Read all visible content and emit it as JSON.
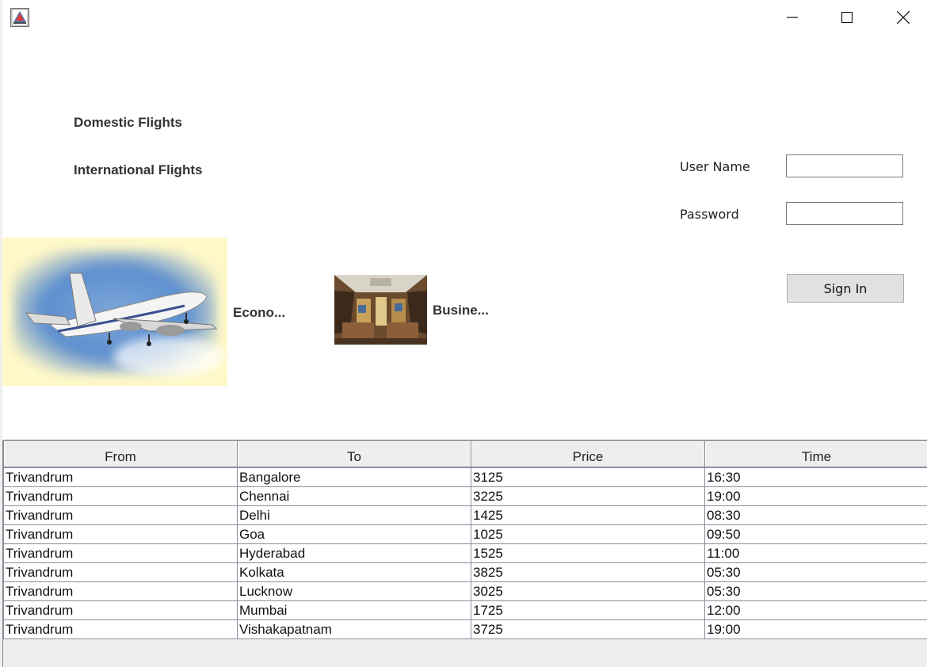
{
  "window": {
    "icon": "java-app-icon",
    "controls": {
      "minimize": "minimize-icon",
      "maximize": "maximize-icon",
      "close": "close-icon"
    }
  },
  "nav": {
    "domestic": "Domestic Flights",
    "international": "International Flights"
  },
  "login": {
    "username_label": "User Name",
    "username_value": "",
    "password_label": "Password",
    "password_value": "",
    "signin_label": "Sign In"
  },
  "classes": {
    "economy_label": "Econo...",
    "business_label": "Busine..."
  },
  "table": {
    "headers": [
      "From",
      "To",
      "Price",
      "Time"
    ],
    "rows": [
      [
        "Trivandrum",
        "Bangalore",
        "3125",
        "16:30"
      ],
      [
        "Trivandrum",
        "Chennai",
        "3225",
        "19:00"
      ],
      [
        "Trivandrum",
        "Delhi",
        "1425",
        "08:30"
      ],
      [
        "Trivandrum",
        "Goa",
        "1025",
        "09:50"
      ],
      [
        "Trivandrum",
        "Hyderabad",
        "1525",
        "11:00"
      ],
      [
        "Trivandrum",
        "Kolkata",
        "3825",
        "05:30"
      ],
      [
        "Trivandrum",
        "Lucknow",
        "3025",
        "05:30"
      ],
      [
        "Trivandrum",
        "Mumbai",
        "1725",
        "12:00"
      ],
      [
        "Trivandrum",
        "Vishakapatnam",
        "3725",
        "19:00"
      ]
    ]
  },
  "colors": {
    "label_text": "#333333",
    "header_bg": "#eeeeee",
    "button_bg": "#e1e1e1"
  }
}
